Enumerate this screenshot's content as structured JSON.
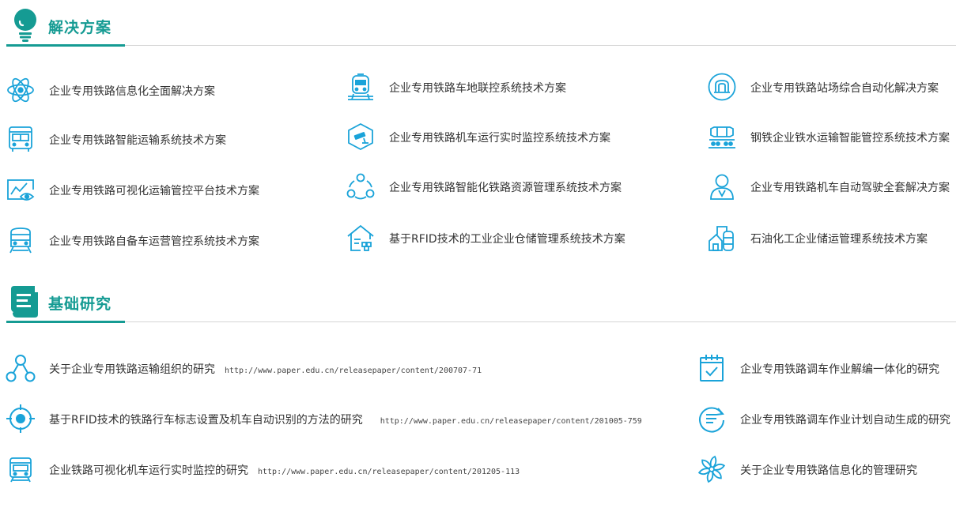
{
  "solutions": {
    "title": "解决方案",
    "items": [
      {
        "label": "企业专用铁路信息化全面解决方案",
        "icon": "atom-icon"
      },
      {
        "label": "企业专用铁路车地联控系统技术方案",
        "icon": "train-front-icon"
      },
      {
        "label": "企业专用铁路站场综合自动化解决方案",
        "icon": "metro-logo-icon"
      },
      {
        "label": "企业专用铁路智能运输系统技术方案",
        "icon": "bus-icon"
      },
      {
        "label": "企业专用铁路机车运行实时监控系统技术方案",
        "icon": "camera-shield-icon"
      },
      {
        "label": "钢铁企业铁水运输智能管控系统技术方案",
        "icon": "ladle-car-icon"
      },
      {
        "label": "企业专用铁路可视化运输管控平台技术方案",
        "icon": "monitor-eye-icon"
      },
      {
        "label": "企业专用铁路智能化铁路资源管理系统技术方案",
        "icon": "network-nodes-icon"
      },
      {
        "label": "企业专用铁路机车自动驾驶全套解决方案",
        "icon": "driver-user-icon"
      },
      {
        "label": "企业专用铁路自备车运营管控系统技术方案",
        "icon": "locomotive-icon"
      },
      {
        "label": "基于RFID技术的工业企业仓储管理系统技术方案",
        "icon": "warehouse-icon"
      },
      {
        "label": "石油化工企业储运管理系统技术方案",
        "icon": "factory-tank-icon"
      }
    ]
  },
  "research": {
    "title": "基础研究",
    "left_items": [
      {
        "label": "关于企业专用铁路运输组织的研究",
        "url": "http://www.paper.edu.cn/releasepaper/content/200707-71",
        "icon": "organization-icon"
      },
      {
        "label": "基于RFID技术的铁路行车标志设置及机车自动识别的方法的研究",
        "url": "http://www.paper.edu.cn/releasepaper/content/201005-759",
        "icon": "target-icon"
      },
      {
        "label": "企业铁路可视化机车运行实时监控的研究",
        "url": "http://www.paper.edu.cn/releasepaper/content/201205-113",
        "icon": "tram-icon"
      }
    ],
    "right_items": [
      {
        "label": "企业专用铁路调车作业解编一体化的研究",
        "icon": "calendar-check-icon"
      },
      {
        "label": "企业专用铁路调车作业计划自动生成的研究",
        "icon": "refresh-list-icon"
      },
      {
        "label": "关于企业专用铁路信息化的管理研究",
        "icon": "pinwheel-icon"
      }
    ]
  },
  "colors": {
    "accent": "#159b93",
    "icon": "#1aa3d9",
    "text": "#333333",
    "rule": "#d6d6d6"
  }
}
